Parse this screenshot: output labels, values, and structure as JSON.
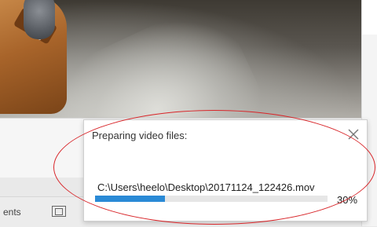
{
  "dialog": {
    "title": "Preparing video files:",
    "file_path": "C:\\Users\\heelo\\Desktop\\20171124_122426.mov",
    "progress_percent": 30,
    "progress_label": "30%",
    "close_icon": "close-icon"
  },
  "status_bar": {
    "left_text": "ents",
    "view_icon": "slideshow-view-icon"
  },
  "colors": {
    "progress_fill": "#2a8ad6",
    "annotation": "#d8262a"
  }
}
